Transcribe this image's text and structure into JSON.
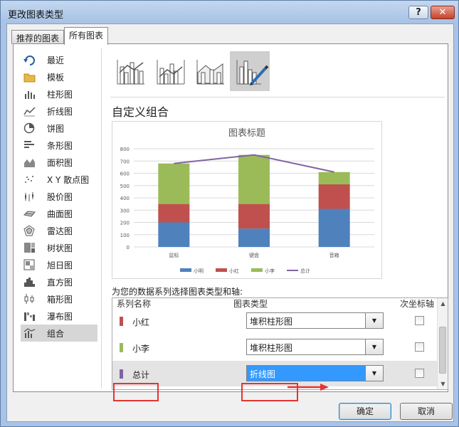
{
  "window": {
    "title": "更改图表类型",
    "help": "?",
    "close": "✕"
  },
  "tabs": [
    "推荐的图表",
    "所有图表"
  ],
  "sidebar": {
    "items": [
      {
        "label": "最近",
        "icon": "recent-icon"
      },
      {
        "label": "模板",
        "icon": "folder-icon"
      },
      {
        "label": "柱形图",
        "icon": "column-chart-icon"
      },
      {
        "label": "折线图",
        "icon": "line-chart-icon"
      },
      {
        "label": "饼图",
        "icon": "pie-chart-icon"
      },
      {
        "label": "条形图",
        "icon": "bar-chart-icon"
      },
      {
        "label": "面积图",
        "icon": "area-chart-icon"
      },
      {
        "label": "X Y 散点图",
        "icon": "scatter-chart-icon"
      },
      {
        "label": "股价图",
        "icon": "stock-chart-icon"
      },
      {
        "label": "曲面图",
        "icon": "surface-chart-icon"
      },
      {
        "label": "雷达图",
        "icon": "radar-chart-icon"
      },
      {
        "label": "树状图",
        "icon": "treemap-chart-icon"
      },
      {
        "label": "旭日图",
        "icon": "sunburst-chart-icon"
      },
      {
        "label": "直方图",
        "icon": "histogram-chart-icon"
      },
      {
        "label": "箱形图",
        "icon": "box-whisker-chart-icon"
      },
      {
        "label": "瀑布图",
        "icon": "waterfall-chart-icon"
      },
      {
        "label": "组合",
        "icon": "combo-chart-icon"
      }
    ],
    "selected_index": 16
  },
  "subtypes": {
    "icons": [
      "clustered-column-line-icon",
      "clustered-column-line-secondary-axis-icon",
      "stacked-area-clustered-column-icon",
      "custom-combo-icon"
    ],
    "selected_index": 3
  },
  "section_title": "自定义组合",
  "chart_data": {
    "type": "bar",
    "title": "图表标题",
    "categories": [
      "鼠标",
      "键盘",
      "音箱"
    ],
    "series": [
      {
        "name": "小明",
        "type": "stacked-bar",
        "values": [
          200,
          150,
          310
        ],
        "color": "#4f81bd"
      },
      {
        "name": "小红",
        "type": "stacked-bar",
        "values": [
          150,
          200,
          200
        ],
        "color": "#c0504d"
      },
      {
        "name": "小李",
        "type": "stacked-bar",
        "values": [
          330,
          400,
          100
        ],
        "color": "#9bbb59"
      },
      {
        "name": "总计",
        "type": "line",
        "values": [
          680,
          750,
          610
        ],
        "color": "#8064a2"
      }
    ],
    "yticks": [
      0,
      100,
      200,
      300,
      400,
      500,
      600,
      700,
      800
    ],
    "ylim": [
      0,
      800
    ],
    "grid": true,
    "legend": "bottom"
  },
  "series_config": {
    "instruction": "为您的数据系列选择图表类型和轴:",
    "headers": {
      "name": "系列名称",
      "type": "图表类型",
      "secondary": "次坐标轴"
    },
    "rows": [
      {
        "name": "小红",
        "color": "#c0504d",
        "type": "堆积柱形图",
        "secondary": false
      },
      {
        "name": "小李",
        "color": "#9bbb59",
        "type": "堆积柱形图",
        "secondary": false
      },
      {
        "name": "总计",
        "color": "#8064a2",
        "type": "折线图",
        "secondary": false
      }
    ]
  },
  "buttons": {
    "ok": "确定",
    "cancel": "取消"
  }
}
